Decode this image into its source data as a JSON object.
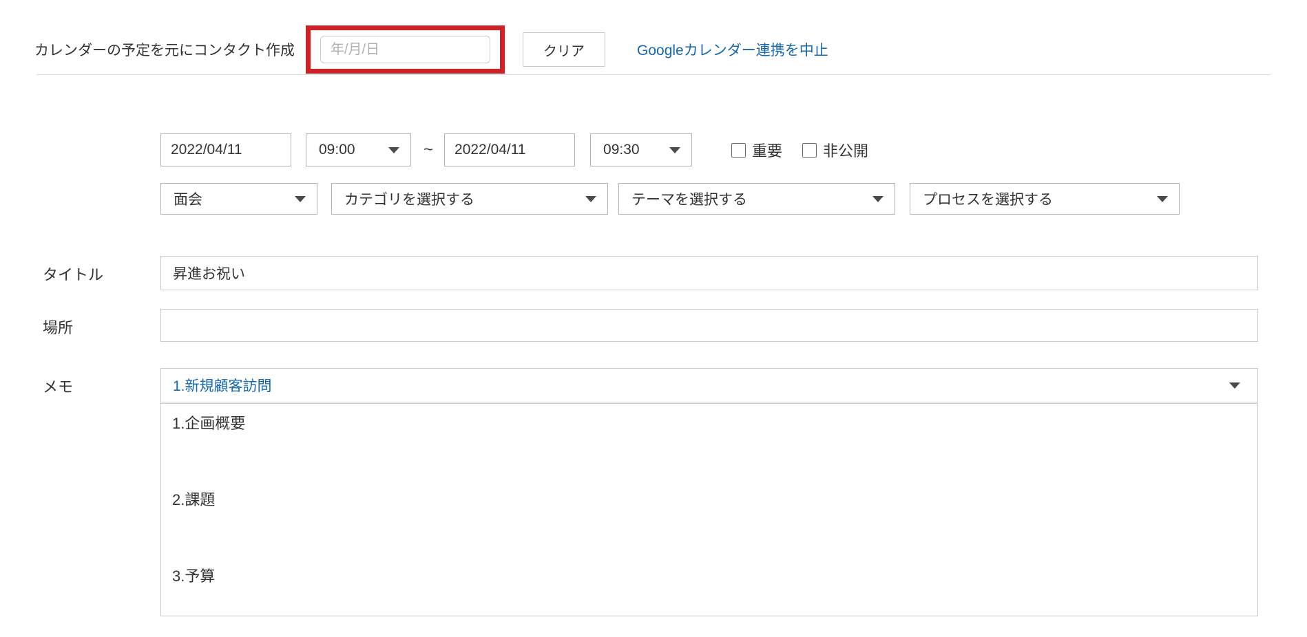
{
  "header": {
    "label": "カレンダーの予定を元にコンタクト作成",
    "date_placeholder": "年/月/日",
    "clear_button_label": "クリア",
    "stop_sync_link": "Googleカレンダー連携を中止"
  },
  "schedule": {
    "start_date": "2022/04/11",
    "start_time": "09:00",
    "separator": "~",
    "end_date": "2022/04/11",
    "end_time": "09:30",
    "important": {
      "label": "重要",
      "checked": false
    },
    "private": {
      "label": "非公開",
      "checked": false
    }
  },
  "classification": {
    "type_value": "面会",
    "category_placeholder": "カテゴリを選択する",
    "theme_placeholder": "テーマを選択する",
    "process_placeholder": "プロセスを選択する"
  },
  "fields": {
    "title": {
      "label": "タイトル",
      "value": "昇進お祝い"
    },
    "location": {
      "label": "場所",
      "value": ""
    },
    "memo": {
      "label": "メモ",
      "template_selected": "1.新規顧客訪問",
      "value": "1.企画概要\n\n\n2.課題\n\n\n3.予算"
    }
  },
  "colors": {
    "highlight_red": "#cc2127",
    "link_blue": "#1668b0",
    "memo_option_blue": "#1668b0",
    "input_border_gray": "#b3b3b3",
    "field_border_gray": "#c9c9c9"
  }
}
